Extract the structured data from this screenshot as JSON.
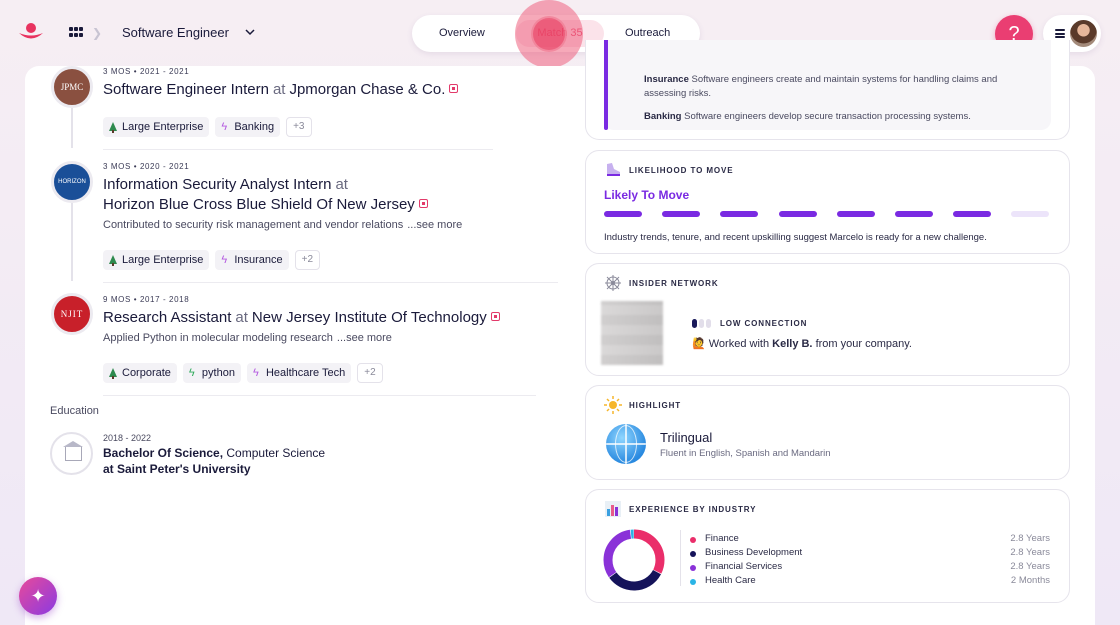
{
  "header": {
    "role_title": "Software Engineer",
    "tabs": [
      {
        "label": "Overview"
      },
      {
        "label": "Match 35"
      },
      {
        "label": "Outreach"
      }
    ],
    "help_label": "?",
    "colors": {
      "accent": "#ea3e72",
      "purple": "#7a2ae2"
    }
  },
  "experience": [
    {
      "meta": "3 MOS • 2021 - 2021",
      "title": "Software Engineer Intern",
      "at": "at",
      "company": "Jpmorgan Chase & Co.",
      "logo_text": "JPMC",
      "tags": [
        "Large Enterprise",
        "Banking",
        "+3"
      ]
    },
    {
      "meta": "3 MOS • 2020 - 2021",
      "title": "Information Security Analyst Intern",
      "at": "at",
      "company": "Horizon Blue Cross Blue Shield Of New Jersey",
      "logo_text": "HORIZON",
      "description": "Contributed to security risk management and vendor relations",
      "see_more": "...see more",
      "tags": [
        "Large Enterprise",
        "Insurance",
        "+2"
      ]
    },
    {
      "meta": "9 MOS • 2017 - 2018",
      "title": "Research Assistant",
      "at": "at",
      "company": "New Jersey Institute Of Technology",
      "logo_text": "NJIT",
      "description": "Applied Python in molecular modeling research",
      "see_more": "...see more",
      "tags": [
        "Corporate",
        "python",
        "Healthcare Tech",
        "+2"
      ]
    }
  ],
  "education": {
    "section_label": "Education",
    "years": "2018 - 2022",
    "degree": "Bachelor Of Science,",
    "field": "Computer Science",
    "school": "at Saint Peter's University"
  },
  "industry_card": {
    "insurance_label": "Insurance",
    "insurance_text": "Software engineers create and maintain systems for handling claims and assessing risks.",
    "banking_label": "Banking",
    "banking_text": "Software engineers develop secure transaction processing systems."
  },
  "likelihood": {
    "title": "LIKELIHOOD TO MOVE",
    "value_label": "Likely To Move",
    "level": 7,
    "max": 8,
    "description": "Industry trends, tenure, and recent upskilling suggest Marcelo is ready for a new challenge."
  },
  "insider": {
    "title": "INSIDER NETWORK",
    "connection_label": "LOW CONNECTION",
    "connection_level": 1,
    "text_prefix": "🙋 Worked with",
    "person": "Kelly B.",
    "text_suffix": "from your company."
  },
  "highlight": {
    "title": "HIGHLIGHT",
    "name": "Trilingual",
    "detail": "Fluent in English, Spanish and Mandarin"
  },
  "chart_data": {
    "type": "pie",
    "title": "EXPERIENCE BY INDUSTRY",
    "categories": [
      "Finance",
      "Business Development",
      "Financial Services",
      "Health Care"
    ],
    "labels": [
      "2.8 Years",
      "2.8 Years",
      "2.8 Years",
      "2 Months"
    ],
    "values": [
      2.8,
      2.8,
      2.8,
      0.17
    ],
    "colors": [
      "#ea2e6a",
      "#15135a",
      "#8a32d8",
      "#2ab4e6"
    ]
  }
}
